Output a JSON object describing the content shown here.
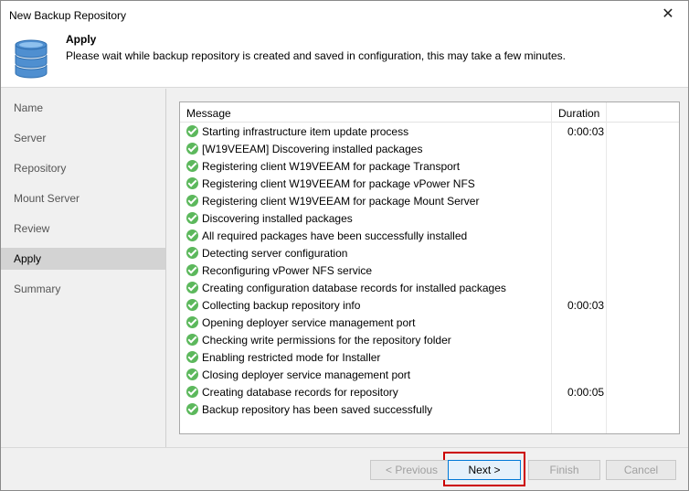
{
  "window": {
    "title": "New Backup Repository",
    "close_glyph": "✕"
  },
  "header": {
    "icon": "database-icon",
    "step_title": "Apply",
    "step_description": "Please wait while backup repository is created and saved in configuration, this may take a few minutes."
  },
  "sidebar": {
    "items": [
      {
        "label": "Name",
        "active": false
      },
      {
        "label": "Server",
        "active": false
      },
      {
        "label": "Repository",
        "active": false
      },
      {
        "label": "Mount Server",
        "active": false
      },
      {
        "label": "Review",
        "active": false
      },
      {
        "label": "Apply",
        "active": true
      },
      {
        "label": "Summary",
        "active": false
      }
    ]
  },
  "log": {
    "columns": {
      "message": "Message",
      "duration": "Duration"
    },
    "status_icon": "success-check-icon",
    "status_color": "#5cb85c",
    "rows": [
      {
        "message": "Starting infrastructure item update process",
        "duration": "0:00:03"
      },
      {
        "message": "[W19VEEAM] Discovering installed packages",
        "duration": ""
      },
      {
        "message": "Registering client W19VEEAM for package Transport",
        "duration": ""
      },
      {
        "message": "Registering client W19VEEAM for package vPower NFS",
        "duration": ""
      },
      {
        "message": "Registering client W19VEEAM for package Mount Server",
        "duration": ""
      },
      {
        "message": "Discovering installed packages",
        "duration": ""
      },
      {
        "message": "All required packages have been successfully installed",
        "duration": ""
      },
      {
        "message": "Detecting server configuration",
        "duration": ""
      },
      {
        "message": "Reconfiguring vPower NFS service",
        "duration": ""
      },
      {
        "message": "Creating configuration database records for installed packages",
        "duration": ""
      },
      {
        "message": "Collecting backup repository info",
        "duration": "0:00:03"
      },
      {
        "message": "Opening deployer service management port",
        "duration": ""
      },
      {
        "message": "Checking write permissions for the repository folder",
        "duration": ""
      },
      {
        "message": "Enabling restricted mode for Installer",
        "duration": ""
      },
      {
        "message": "Closing deployer service management port",
        "duration": ""
      },
      {
        "message": "Creating database records for repository",
        "duration": "0:00:05"
      },
      {
        "message": "Backup repository has been saved successfully",
        "duration": ""
      }
    ]
  },
  "footer": {
    "previous_label": "< Previous",
    "next_label": "Next >",
    "finish_label": "Finish",
    "cancel_label": "Cancel",
    "highlight_color": "#cc0000"
  }
}
